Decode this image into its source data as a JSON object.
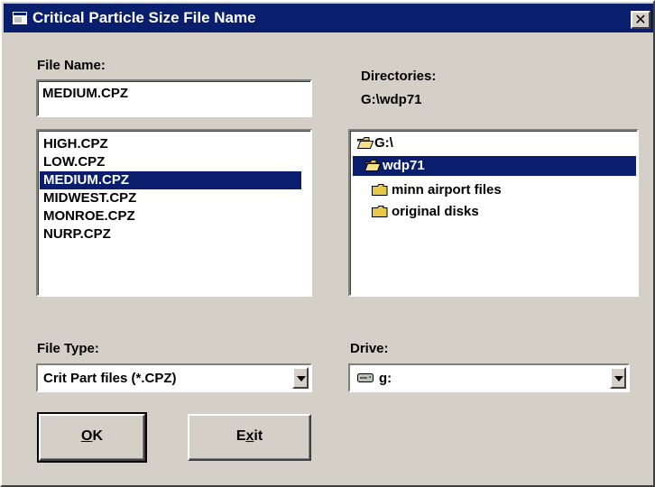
{
  "window": {
    "title": "Critical Particle Size File Name",
    "close_glyph": "✕"
  },
  "file_name": {
    "label": "File Name:",
    "value": "MEDIUM.CPZ"
  },
  "files": {
    "items": [
      "HIGH.CPZ",
      "LOW.CPZ",
      "MEDIUM.CPZ",
      "MIDWEST.CPZ",
      "MONROE.CPZ",
      "NURP.CPZ"
    ],
    "selected": "MEDIUM.CPZ"
  },
  "directories": {
    "label": "Directories:",
    "current_path": "G:\\wdp71",
    "tree": [
      {
        "name": "G:\\",
        "icon": "open-folder-icon"
      },
      {
        "name": "wdp71",
        "icon": "open-folder-icon",
        "selected": true
      },
      {
        "name": "minn airport files",
        "icon": "folder-icon"
      },
      {
        "name": "original disks",
        "icon": "folder-icon"
      }
    ]
  },
  "file_type": {
    "label": "File Type:",
    "value": "Crit Part files (*.CPZ)"
  },
  "drive": {
    "label": "Drive:",
    "value": "g:",
    "icon": "drive-icon"
  },
  "buttons": {
    "ok": {
      "label_rest": "K",
      "mnemonic": "O"
    },
    "exit": {
      "label_pre": "E",
      "mnemonic": "x",
      "label_post": "it"
    }
  },
  "colors": {
    "titlebar": "#0a1e6e",
    "selection": "#0a1e6e",
    "face": "#d4d0c8",
    "folder": "#e8c84a"
  }
}
